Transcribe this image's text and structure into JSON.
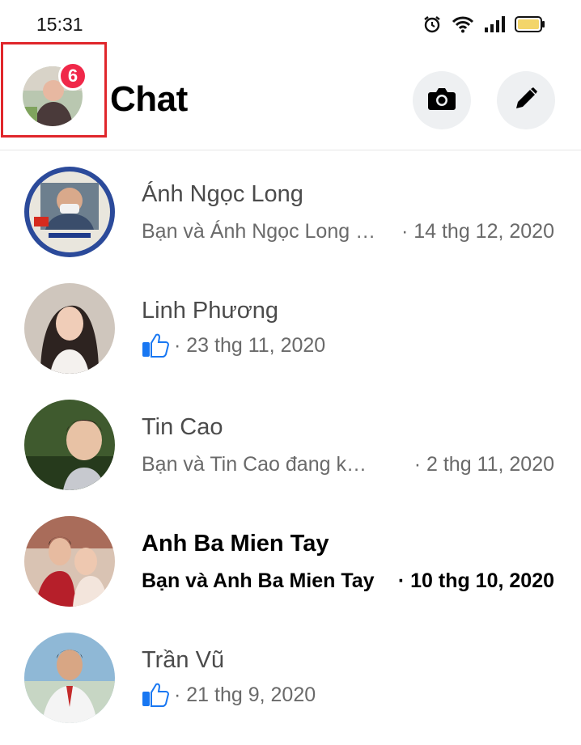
{
  "status_bar": {
    "time": "15:31",
    "icons": [
      "alarm-icon",
      "wifi-icon",
      "signal-icon",
      "battery-icon"
    ]
  },
  "header": {
    "title": "Chat",
    "notification_count": "6",
    "buttons": [
      "camera-icon",
      "pencil-icon"
    ]
  },
  "colors": {
    "badge": "#f02849",
    "highlight_border": "#e0262b",
    "button_bg": "#eef0f2",
    "like_blue": "#1877f2"
  },
  "chats": [
    {
      "name": "Ánh Ngọc Long",
      "preview": "Bạn và Ánh Ngọc Long đã là bạn bè",
      "time": "· 14 thg 12, 2020",
      "unread": false
    },
    {
      "name": "Linh Phương",
      "preview": "",
      "like_icon": "thumbs-up-icon",
      "time": "· 23 thg 11, 2020",
      "unread": false
    },
    {
      "name": "Tin Cao",
      "preview": "Bạn và Tin Cao đang kỷ niệm",
      "time": "· 2 thg 11, 2020",
      "unread": false
    },
    {
      "name": "Anh Ba Mien Tay",
      "preview": "Bạn và Anh Ba Mien Tay",
      "time": "· 10 thg 10, 2020",
      "unread": true
    },
    {
      "name": "Trần Vũ",
      "preview": "",
      "like_icon": "thumbs-up-icon",
      "time": "· 21 thg 9, 2020",
      "unread": false
    }
  ]
}
